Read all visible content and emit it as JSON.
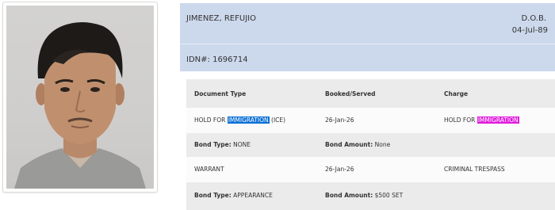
{
  "person": {
    "name": "JIMENEZ, REFUJIO",
    "dob_label": "D.O.B.",
    "dob_value": "04-Jul-89",
    "idn_label": "IDN#:",
    "idn_value": "1696714"
  },
  "charges_table": {
    "headers": {
      "document_type": "Document Type",
      "booked_served": "Booked/Served",
      "charge": "Charge"
    },
    "rows": [
      {
        "document_prefix": "HOLD FOR ",
        "document_highlight": "IMMIGRATION",
        "document_suffix": " (ICE)",
        "booked": "26-Jan-26",
        "charge_prefix": "HOLD FOR ",
        "charge_highlight": "IMMIGRATION"
      },
      {
        "bond_type_label": "Bond Type:",
        "bond_type_value": " NONE",
        "bond_amount_label": "Bond Amount:",
        "bond_amount_value": " None"
      },
      {
        "document": "WARRANT",
        "booked": "26-Jan-26",
        "charge": "CRIMINAL TRESPASS"
      },
      {
        "bond_type_label": "Bond Type:",
        "bond_type_value": " APPEARANCE",
        "bond_amount_label": "Bond Amount:",
        "bond_amount_value": " $500 SET"
      }
    ]
  },
  "colors": {
    "header_bg": "#ccd8ec",
    "row_shade": "#ebebeb",
    "highlight_blue": "#0a6fd6",
    "highlight_magenta": "#e01adc"
  }
}
